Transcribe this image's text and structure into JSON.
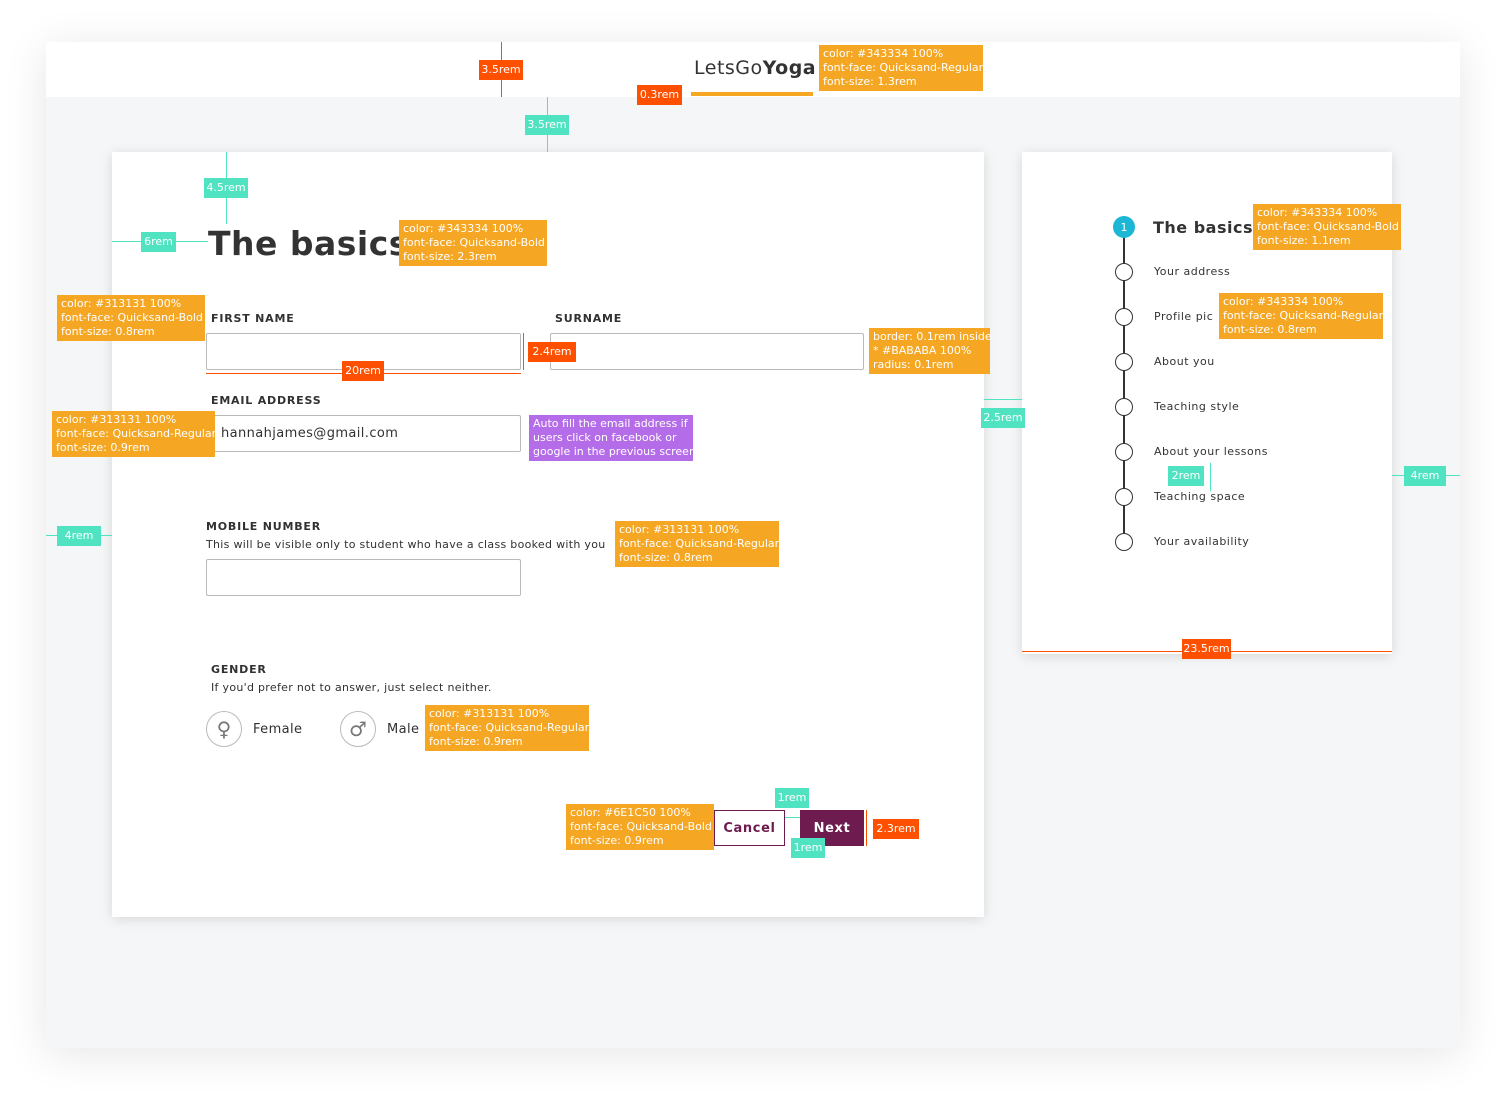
{
  "brand": {
    "prefix": "LetsGo",
    "suffix": "Yoga",
    "underline_color": "#f5a623"
  },
  "page": {
    "title": "The basics"
  },
  "form": {
    "first_name": {
      "label": "FIRST NAME",
      "value": ""
    },
    "surname": {
      "label": "SURNAME",
      "value": ""
    },
    "email": {
      "label": "EMAIL ADDRESS",
      "value": "hannahjames@gmail.com"
    },
    "mobile": {
      "label": "MOBILE NUMBER",
      "help": "This will be visible only to student who have a class booked with you",
      "value": ""
    },
    "gender": {
      "label": "GENDER",
      "help": "If you'd prefer not to answer, just select neither.",
      "options": [
        {
          "label": "Female",
          "icon": "female-icon",
          "glyph": "♀"
        },
        {
          "label": "Male",
          "icon": "male-icon",
          "glyph": "♂"
        }
      ]
    },
    "buttons": {
      "cancel": "Cancel",
      "next": "Next",
      "color": "#6e1c50"
    }
  },
  "steps": {
    "active_color": "#1cb7d4",
    "active_number": "1",
    "items": [
      {
        "label": "The basics",
        "active": true
      },
      {
        "label": "Your address"
      },
      {
        "label": "Profile pic"
      },
      {
        "label": "About you"
      },
      {
        "label": "Teaching style"
      },
      {
        "label": "About your lessons"
      },
      {
        "label": "Teaching space"
      },
      {
        "label": "Your availability"
      }
    ]
  },
  "annotations": {
    "logo_spec": [
      "color: #343334 100%",
      "font-face: Quicksand-Regular",
      "font-size: 1.3rem"
    ],
    "title_spec": [
      "color: #343334 100%",
      "font-face: Quicksand-Bold",
      "font-size: 2.3rem"
    ],
    "label_spec": [
      "color: #313131 100%",
      "font-face: Quicksand-Bold",
      "font-size: 0.8rem"
    ],
    "input_spec": [
      "border: 0.1rem inside",
      " * #BABABA 100%",
      "radius: 0.1rem"
    ],
    "input_text_spec": [
      "color: #313131 100%",
      "font-face: Quicksand-Regular",
      "font-size: 0.9rem"
    ],
    "autofill_note": [
      "Auto fill the email address if",
      "users click on facebook or",
      "google in the previous screen."
    ],
    "help_spec": [
      "color: #313131 100%",
      "font-face: Quicksand-Regular",
      "font-size: 0.8rem"
    ],
    "gender_spec": [
      "color: #313131 100%",
      "font-face: Quicksand-Regular",
      "font-size: 0.9rem"
    ],
    "button_spec": [
      "color: #6E1C50 100%",
      "font-face: Quicksand-Bold",
      "font-size: 0.9rem"
    ],
    "step_title_spec": [
      "color: #343334 100%",
      "font-face: Quicksand-Bold",
      "font-size: 1.1rem"
    ],
    "step_item_spec": [
      "color: #343334 100%",
      "font-face: Quicksand-Regular",
      "font-size: 0.8rem"
    ],
    "measures": {
      "header_height": "3.5rem",
      "underline": "0.3rem",
      "top_gap": "3.5rem",
      "title_top": "4.5rem",
      "left_pad": "6rem",
      "input_height": "2.4rem",
      "input_width": "20rem",
      "card_gap": "2.5rem",
      "outer_left": "4rem",
      "outer_right": "4rem",
      "step_gap": "2rem",
      "sidebar_width": "23.5rem",
      "btn_gap": "1rem",
      "btn_pad": "1rem",
      "btn_height": "2.3rem"
    }
  }
}
